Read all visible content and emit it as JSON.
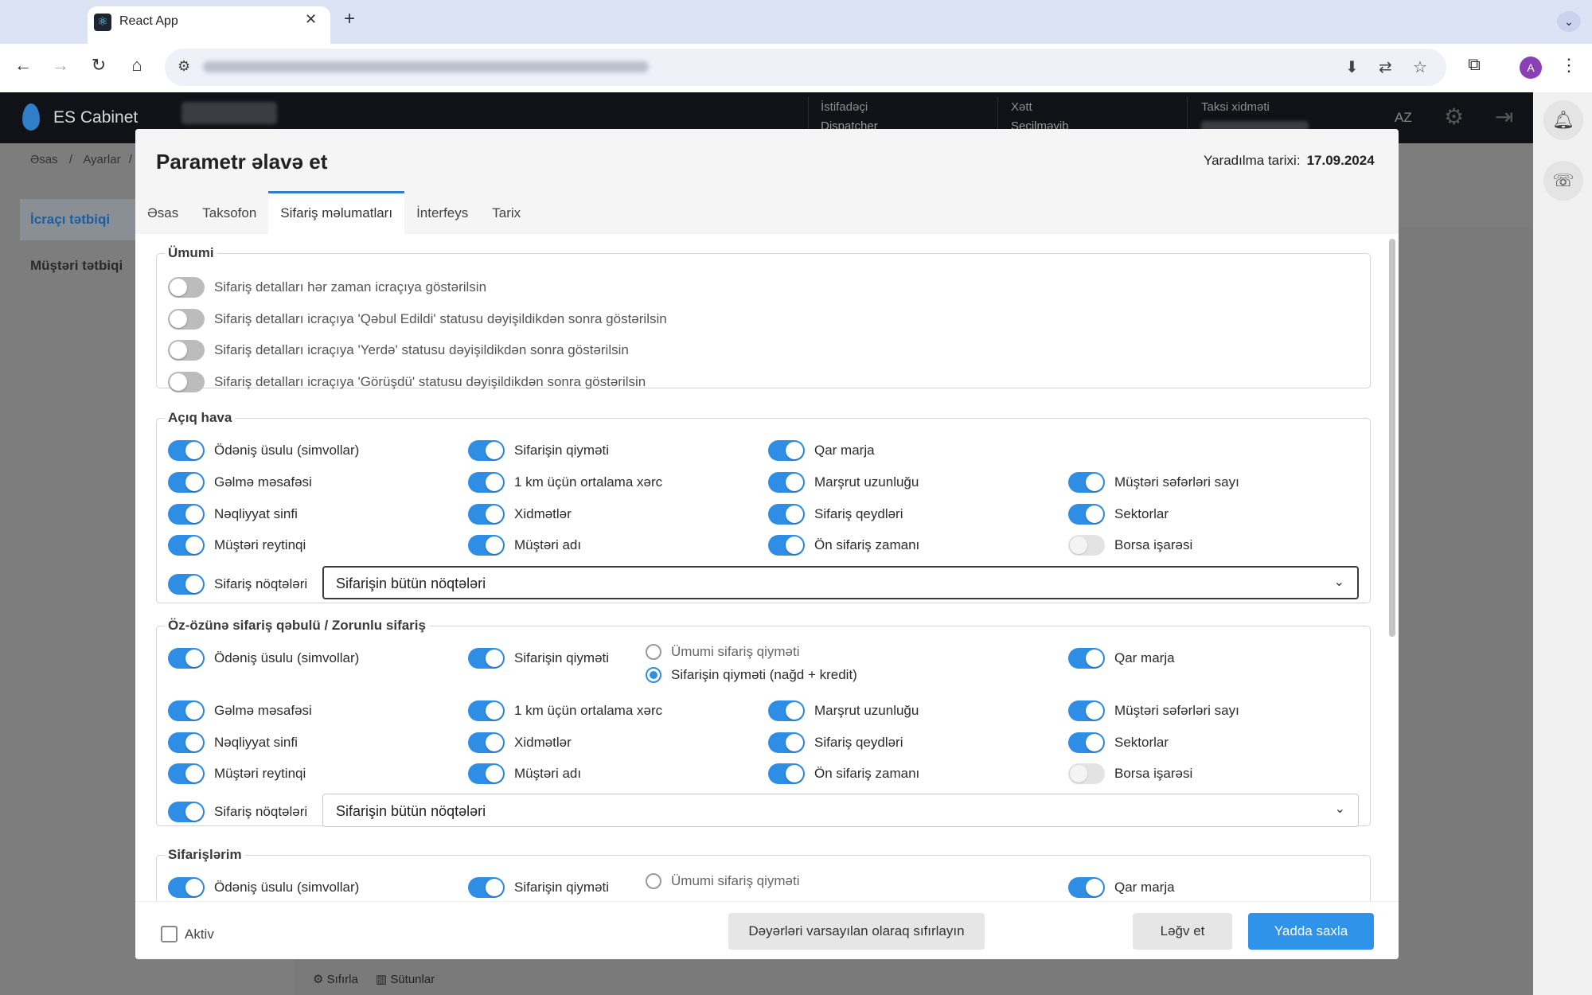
{
  "browser": {
    "tab_title": "React App",
    "close_glyph": "✕",
    "new_tab_glyph": "+",
    "menu_glyph": "⌄",
    "profile_initial": "A"
  },
  "app": {
    "logo_text": "ES Cabinet",
    "header": {
      "user_label": "İstifadəçi",
      "user_value": "Dispatcher",
      "line_label": "Xətt",
      "line_value": "Seçilməyib",
      "taxi_label": "Taksi xidməti",
      "language": "AZ"
    },
    "breadcrumb": [
      "Əsas",
      "/",
      "Ayarlar",
      "/"
    ],
    "sidebar": [
      "İcraçı tətbiqi",
      "Müştəri tətbiqi"
    ],
    "footer_tools": [
      "Sıfırla",
      "Sütunlar"
    ]
  },
  "modal": {
    "title": "Parametr əlavə et",
    "created_label": "Yaradılma tarixi:",
    "created_value": "17.09.2024",
    "tabs": [
      "Əsas",
      "Taksofon",
      "Sifariş məlumatları",
      "İnterfeys",
      "Tarix"
    ],
    "active_tab": "Sifariş məlumatları",
    "sections": {
      "general": {
        "title": "Ümumi",
        "items": [
          {
            "label": "Sifariş detalları hər zaman icraçıya göstərilsin",
            "on": false
          },
          {
            "label": "Sifariş detalları icraçıya 'Qəbul Edildi' statusu dəyişildikdən sonra göstərilsin",
            "on": false
          },
          {
            "label": "Sifariş detalları icraçıya 'Yerdə' statusu dəyişildikdən sonra göstərilsin",
            "on": false
          },
          {
            "label": "Sifariş detalları icraçıya 'Görüşdü' statusu dəyişildikdən sonra göstərilsin",
            "on": false
          }
        ]
      },
      "open_air": {
        "title": "Açıq hava",
        "rows": [
          [
            "Ödəniş üsulu (simvollar)",
            "Sifarişin qiyməti",
            "Qar marja",
            ""
          ],
          [
            "Gəlmə məsafəsi",
            "1 km üçün ortalama xərc",
            "Marşrut uzunluğu",
            "Müştəri səfərləri sayı"
          ],
          [
            "Nəqliyyat sinfi",
            "Xidmətlər",
            "Sifariş qeydləri",
            "Sektorlar"
          ],
          [
            "Müştəri reytinqi",
            "Müştəri adı",
            "Ön sifariş zamanı",
            "Borsa işarəsi"
          ]
        ],
        "points_label": "Sifariş nöqtələri",
        "points_select": "Sifarişin bütün nöqtələri"
      },
      "self_accept": {
        "title": "Öz-özünə sifariş qəbulü / Zorunlu sifariş",
        "top": {
          "payment": "Ödəniş üsulu (simvollar)",
          "price": "Sifarişin qiyməti",
          "snow": "Qar marja"
        },
        "radio_options": [
          "Ümumi sifariş qiyməti",
          "Sifarişin qiyməti (nağd + kredit)"
        ],
        "radio_selected": 1,
        "rows": [
          [
            "Gəlmə məsafəsi",
            "1 km üçün ortalama xərc",
            "Marşrut uzunluğu",
            "Müştəri səfərləri sayı"
          ],
          [
            "Nəqliyyat sinfi",
            "Xidmətlər",
            "Sifariş qeydləri",
            "Sektorlar"
          ],
          [
            "Müştəri reytinqi",
            "Müştəri adı",
            "Ön sifariş zamanı",
            "Borsa işarəsi"
          ]
        ],
        "points_label": "Sifariş nöqtələri",
        "points_select": "Sifarişin bütün nöqtələri"
      },
      "my_orders": {
        "title": "Sifarişlərim",
        "top": {
          "payment": "Ödəniş üsulu (simvollar)",
          "price": "Sifarişin qiyməti",
          "radio": "Ümumi sifariş qiyməti",
          "snow": "Qar marja"
        }
      }
    },
    "footer": {
      "active_label": "Aktiv",
      "reset_label": "Dəyərləri varsayılan olaraq sıfırlayın",
      "cancel_label": "Ləğv et",
      "save_label": "Yadda saxla"
    }
  }
}
